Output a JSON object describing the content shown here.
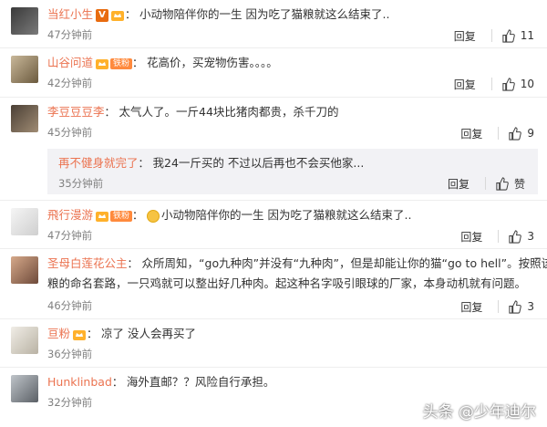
{
  "comments": [
    {
      "name": "当红小生",
      "text": "小动物陪伴你的一生 因为吃了猫粮就这么结束了..",
      "time": "47分钟前",
      "reply_label": "回复",
      "likes": "11",
      "has_v": true,
      "has_crown": true,
      "fan_label": ""
    },
    {
      "name": "山谷问道",
      "text": "花高价，买宠物伤害。。。。",
      "time": "42分钟前",
      "reply_label": "回复",
      "likes": "10",
      "has_v": false,
      "has_crown": true,
      "fan_label": "铁粉"
    },
    {
      "name": "李豆豆豆李",
      "text": "太气人了。一斤44块比猪肉都贵，杀千刀的",
      "time": "45分钟前",
      "reply_label": "回复",
      "likes": "9",
      "has_v": false,
      "has_crown": false,
      "fan_label": ""
    },
    {
      "name": "飛行漫游",
      "text": "小动物陪伴你的一生 因为吃了猫粮就这么结束了..",
      "time": "47分钟前",
      "reply_label": "回复",
      "likes": "3",
      "has_v": false,
      "has_crown": true,
      "fan_label": "铁粉",
      "emoji": "frown-emoji"
    },
    {
      "name": "圣母白莲花公主",
      "text": "众所周知，“go九种肉”并没有“九种肉”，但是却能让你的猫“go to hell”。按照该毒",
      "text2": "粮的命名套路，一只鸡就可以整出好几种肉。起这种名字吸引眼球的厂家，本身动机就有问题。",
      "time": "46分钟前",
      "reply_label": "回复",
      "likes": "3",
      "has_v": false,
      "has_crown": false,
      "fan_label": ""
    },
    {
      "name": "亘粉",
      "text": "凉了 没人会再买了",
      "time": "36分钟前",
      "reply_label": "回复",
      "likes": "",
      "has_v": false,
      "has_crown": true,
      "fan_label": "",
      "like_label": "赞"
    },
    {
      "name": "Hunklinbad",
      "text": "海外直邮？？风险自行承担。",
      "time": "32分钟前",
      "reply_label": "回复",
      "likes": "",
      "has_v": false,
      "has_crown": false,
      "fan_label": "",
      "like_label": "赞"
    }
  ],
  "nested_reply": {
    "name": "再不健身就完了",
    "text": "我24一斤买的 不过以后再也不会买他家...",
    "time": "35分钟前",
    "reply_label": "回复",
    "like_label": "赞"
  },
  "watermark": "头条 @少年迪尔",
  "colors": {
    "name": "#eb7350",
    "text": "#333333",
    "time": "#808080",
    "reply_bg": "#f2f2f5"
  }
}
